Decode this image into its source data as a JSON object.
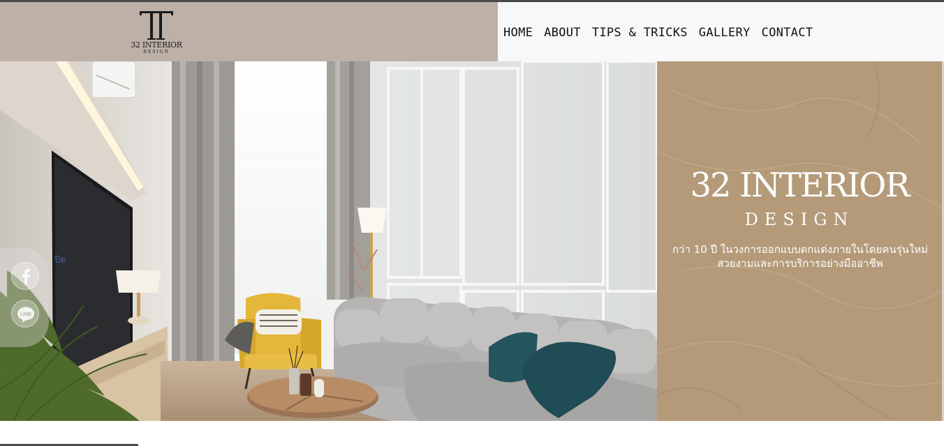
{
  "brand": {
    "logo_monogram": "T",
    "logo_name": "32 INTERIOR",
    "logo_sub": "DESIGN"
  },
  "nav": {
    "items": [
      {
        "label": "HOME"
      },
      {
        "label": "ABOUT"
      },
      {
        "label": "TIPS & TRICKS"
      },
      {
        "label": "GALLERY"
      },
      {
        "label": "CONTACT"
      }
    ]
  },
  "hero": {
    "title": "32 INTERIOR",
    "subtitle": "DESIGN",
    "description": "กว่า 10 ปี ในวงการออกแบบตกแต่งภายในโดยคนรุ่นใหม่ สวยงามและการบริการอย่างมืออาชีพ"
  },
  "social": {
    "close_label": "ปิด",
    "facebook_icon": "facebook-icon",
    "line_icon": "line-icon",
    "line_text": "LINE"
  },
  "colors": {
    "logo_panel": "#bcb0a7",
    "nav_panel": "#f6f8fa",
    "hero_panel": "#b49a78",
    "accent_text": "#ffffff"
  }
}
